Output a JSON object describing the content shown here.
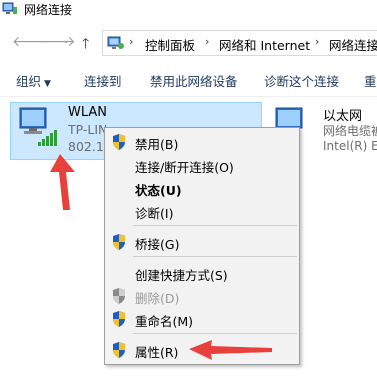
{
  "window": {
    "title": "网络连接"
  },
  "address": {
    "crumbs": [
      "控制面板",
      "网络和 Internet",
      "网络连接"
    ]
  },
  "toolbar": {
    "organize_label": "组织",
    "connect_label": "连接到",
    "disable_label": "禁用此网络设备",
    "diagnose_label": "诊断这个连接",
    "rename_label": "重"
  },
  "connections": {
    "wlan": {
      "name": "WLAN",
      "ssid": "TP-LIN",
      "adapter": "802.1"
    },
    "ethernet": {
      "name": "以太网",
      "status": "网络电缆被",
      "adapter": "Intel(R) Et"
    }
  },
  "context_menu": {
    "items": [
      {
        "label": "禁用(B)",
        "shield": true,
        "bold": false,
        "disabled": false
      },
      {
        "label": "连接/断开连接(O)",
        "shield": false,
        "bold": false,
        "disabled": false
      },
      {
        "label": "状态(U)",
        "shield": false,
        "bold": true,
        "disabled": false
      },
      {
        "label": "诊断(I)",
        "shield": false,
        "bold": false,
        "disabled": false
      },
      {
        "label": "桥接(G)",
        "shield": true,
        "bold": false,
        "disabled": false
      },
      {
        "label": "创建快捷方式(S)",
        "shield": false,
        "bold": false,
        "disabled": false
      },
      {
        "label": "删除(D)",
        "shield": true,
        "bold": false,
        "disabled": true
      },
      {
        "label": "重命名(M)",
        "shield": true,
        "bold": false,
        "disabled": false
      },
      {
        "label": "属性(R)",
        "shield": true,
        "bold": false,
        "disabled": false
      }
    ]
  },
  "colors": {
    "selection_bg": "#cce8ff",
    "selection_border": "#99d1ff",
    "annotation_arrow": "#e8403a",
    "toolbar_text": "#1e395b"
  },
  "icons": {
    "nav_back": "arrow-left-icon",
    "nav_forward": "arrow-right-icon",
    "nav_recent": "chevron-down-icon",
    "nav_up": "arrow-up-icon",
    "network": "network-adapter-icon",
    "uac": "uac-shield-icon"
  }
}
